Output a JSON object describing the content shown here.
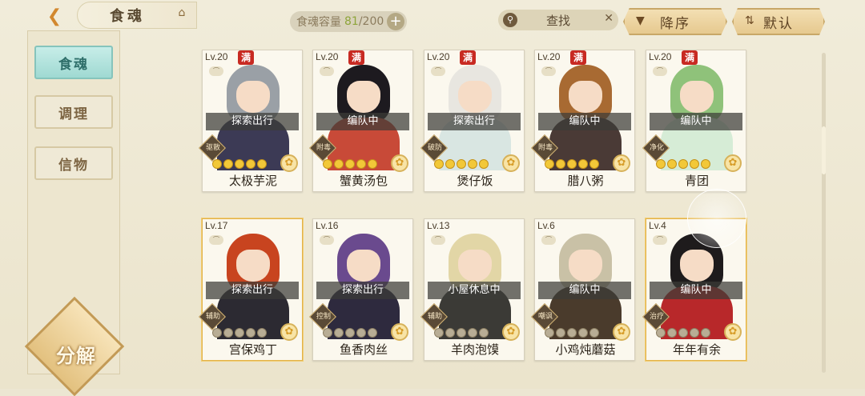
{
  "header": {
    "title": "食魂",
    "capacity_label": "食魂容量",
    "capacity_current": "81",
    "capacity_max": "/200",
    "search_label": "查找",
    "sort_label": "降序",
    "default_label": "默认"
  },
  "sidebar": {
    "items": [
      {
        "label": "食魂",
        "active": true
      },
      {
        "label": "调理",
        "active": false
      },
      {
        "label": "信物",
        "active": false
      }
    ],
    "decompose_label": "分解"
  },
  "cards": [
    {
      "level": "Lv.20",
      "full": "满",
      "status": "探索出行",
      "type": "驱散",
      "name": "太极芋泥",
      "stars": 5,
      "hair": "#9aa0a6",
      "outfit": "#3c3a55",
      "gold": false
    },
    {
      "level": "Lv.20",
      "full": "满",
      "status": "编队中",
      "type": "附毒",
      "name": "蟹黄汤包",
      "stars": 5,
      "hair": "#1d1a1f",
      "outfit": "#c84a38",
      "gold": false
    },
    {
      "level": "Lv.20",
      "full": "满",
      "status": "探索出行",
      "type": "破防",
      "name": "煲仔饭",
      "stars": 5,
      "hair": "#e8e6e0",
      "outfit": "#d9e6e2",
      "gold": false
    },
    {
      "level": "Lv.20",
      "full": "满",
      "status": "编队中",
      "type": "附毒",
      "name": "腊八粥",
      "stars": 5,
      "hair": "#a86a32",
      "outfit": "#4a3a36",
      "gold": false
    },
    {
      "level": "Lv.20",
      "full": "满",
      "status": "编队中",
      "type": "净化",
      "name": "青团",
      "stars": 5,
      "hair": "#8fc27a",
      "outfit": "#d6ecd6",
      "gold": false
    },
    {
      "level": "Lv.17",
      "full": "",
      "status": "探索出行",
      "type": "辅助",
      "name": "宫保鸡丁",
      "stars": 0,
      "hair": "#c8441f",
      "outfit": "#2c2a32",
      "gold": true
    },
    {
      "level": "Lv.16",
      "full": "",
      "status": "探索出行",
      "type": "控制",
      "name": "鱼香肉丝",
      "stars": 0,
      "hair": "#6a4a8e",
      "outfit": "#2e2a3e",
      "gold": false
    },
    {
      "level": "Lv.13",
      "full": "",
      "status": "小屋休息中",
      "type": "辅助",
      "name": "羊肉泡馍",
      "stars": 0,
      "hair": "#e2d6a6",
      "outfit": "#3b3a36",
      "gold": false
    },
    {
      "level": "Lv.6",
      "full": "",
      "status": "编队中",
      "type": "嘲讽",
      "name": "小鸡炖蘑菇",
      "stars": 0,
      "hair": "#c9c1a6",
      "outfit": "#4a3b2c",
      "gold": false
    },
    {
      "level": "Lv.4",
      "full": "",
      "status": "编队中",
      "type": "治疗",
      "name": "年年有余",
      "stars": 0,
      "hair": "#1e1b1c",
      "outfit": "#b8282a",
      "gold": true
    }
  ]
}
